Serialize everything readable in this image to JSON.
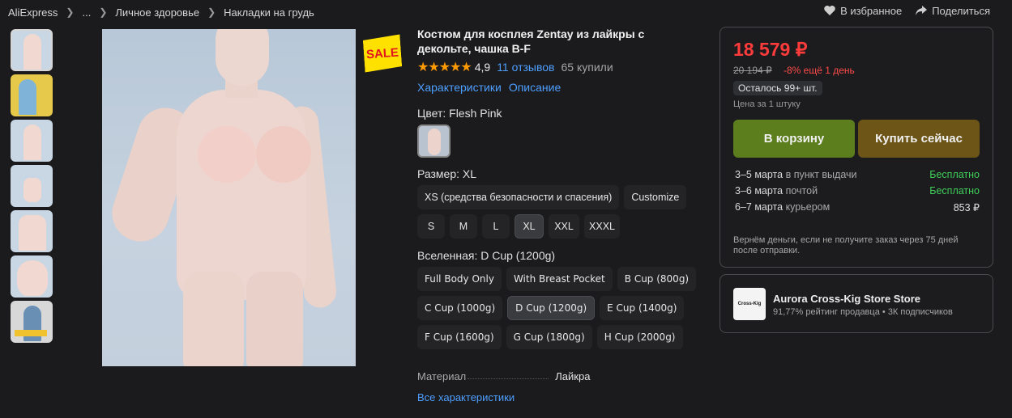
{
  "breadcrumb": [
    "AliExpress",
    "...",
    "Личное здоровье",
    "Накладки на грудь"
  ],
  "top_actions": {
    "favorite": "В избранное",
    "share": "Поделиться"
  },
  "badge": "SALE",
  "product": {
    "title_line1": "Костюм для косплея Zentay из лайкры с",
    "title_line2": "декольте, чашка B-F",
    "rating": "4,9",
    "reviews": "11 отзывов",
    "sold": "65 купили",
    "tab_specs": "Характеристики",
    "tab_desc": "Описание",
    "color_label": "Цвет: Flesh Pink",
    "size_label": "Размер: XL",
    "size_row1": [
      "XS (средства безопасности и спасения)",
      "Customize"
    ],
    "size_row2": [
      "S",
      "M",
      "L",
      "XL",
      "XXL",
      "XXXL"
    ],
    "size_selected": "XL",
    "universe_label": "Вселенная: D Cup (1200g)",
    "universe_row1": [
      "Full Body Only",
      "With Breast Pocket",
      "B Cup (800g)"
    ],
    "universe_row2": [
      "C Cup (1000g)",
      "D Cup (1200g)",
      "E Cup (1400g)"
    ],
    "universe_row3": [
      "F Cup (1600g)",
      "G Cup (1800g)",
      "H Cup (2000g)"
    ],
    "universe_selected": "D Cup (1200g)",
    "material_key": "Материал",
    "material_val": "Лайкра",
    "all_specs": "Все характеристики"
  },
  "purchase": {
    "price": "18 579 ₽",
    "old_price": "20 194 ₽",
    "discount": "-8% ещё 1 день",
    "stock": "Осталось 99+ шт.",
    "per_unit": "Цена за 1 штуку",
    "cart_button": "В корзину",
    "buy_button": "Купить сейчас",
    "shipping": [
      {
        "date": "3–5 марта",
        "method": "в пункт выдачи",
        "price": "Бесплатно",
        "free": true
      },
      {
        "date": "3–6 марта",
        "method": "почтой",
        "price": "Бесплатно",
        "free": true
      },
      {
        "date": "6–7 марта",
        "method": "курьером",
        "price": "853 ₽",
        "free": false
      }
    ],
    "refund_line1": "Вернём деньги, если не получите заказ через 75 дней",
    "refund_line2": "после отправки."
  },
  "store": {
    "logo_text": "Cross-Kig",
    "name": "Aurora Cross-Kig Store Store",
    "rating": "91,77% рейтинг продавца",
    "subscribers": "3К подписчиков"
  },
  "colors": {
    "price": "#ff3b3b",
    "link": "#4d9fff",
    "cart": "#5c7e1c",
    "buy": "#6c5517",
    "free": "#3fcf5a"
  }
}
